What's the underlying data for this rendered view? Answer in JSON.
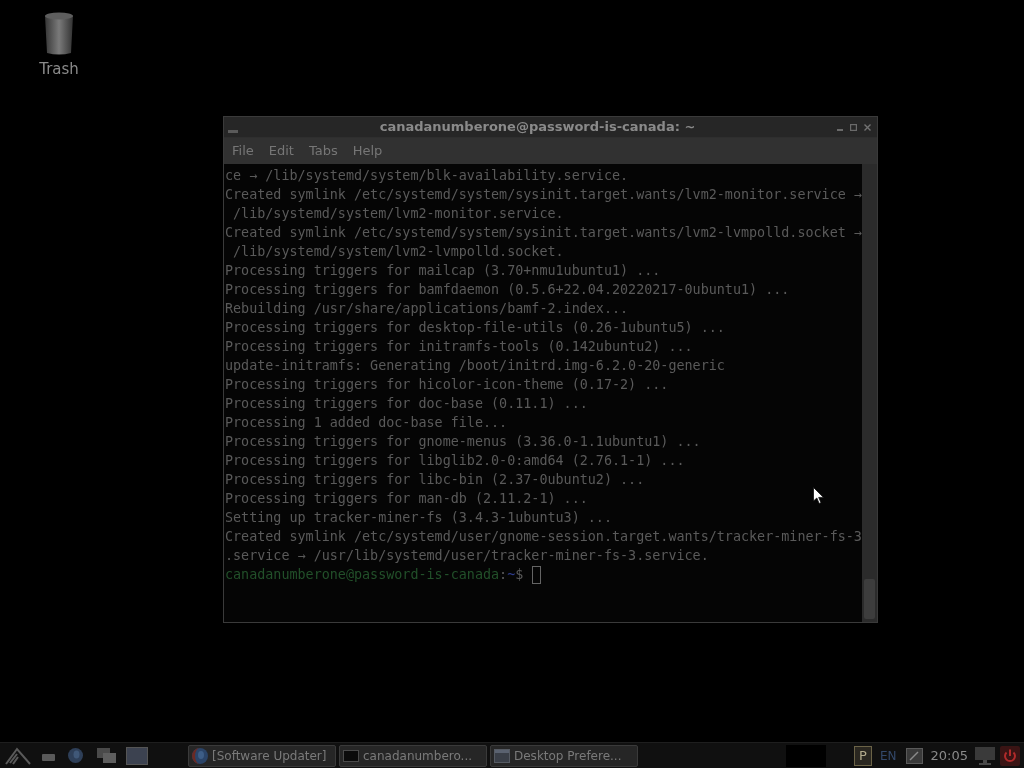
{
  "desktop": {
    "icons": [
      {
        "label": "Trash"
      }
    ]
  },
  "window": {
    "title": "canadanumberone@password-is-canada: ~",
    "menu": [
      "File",
      "Edit",
      "Tabs",
      "Help"
    ],
    "terminal": {
      "lines": [
        "ce → /lib/systemd/system/blk-availability.service.",
        "Created symlink /etc/systemd/system/sysinit.target.wants/lvm2-monitor.service →",
        " /lib/systemd/system/lvm2-monitor.service.",
        "Created symlink /etc/systemd/system/sysinit.target.wants/lvm2-lvmpolld.socket →",
        " /lib/systemd/system/lvm2-lvmpolld.socket.",
        "Processing triggers for mailcap (3.70+nmu1ubuntu1) ...",
        "Processing triggers for bamfdaemon (0.5.6+22.04.20220217-0ubuntu1) ...",
        "Rebuilding /usr/share/applications/bamf-2.index...",
        "Processing triggers for desktop-file-utils (0.26-1ubuntu5) ...",
        "Processing triggers for initramfs-tools (0.142ubuntu2) ...",
        "update-initramfs: Generating /boot/initrd.img-6.2.0-20-generic",
        "Processing triggers for hicolor-icon-theme (0.17-2) ...",
        "Processing triggers for doc-base (0.11.1) ...",
        "Processing 1 added doc-base file...",
        "Processing triggers for gnome-menus (3.36.0-1.1ubuntu1) ...",
        "Processing triggers for libglib2.0-0:amd64 (2.76.1-1) ...",
        "Processing triggers for libc-bin (2.37-0ubuntu2) ...",
        "Processing triggers for man-db (2.11.2-1) ...",
        "Setting up tracker-miner-fs (3.4.3-1ubuntu3) ...",
        "Created symlink /etc/systemd/user/gnome-session.target.wants/tracker-miner-fs-3",
        ".service → /usr/lib/systemd/user/tracker-miner-fs-3.service."
      ],
      "prompt": {
        "user_host": "canadanumberone@password-is-canada",
        "separator": ":",
        "path": "~",
        "symbol": "$"
      }
    }
  },
  "taskbar": {
    "tasks": [
      {
        "label": "[Software Updater]",
        "kind": "updater"
      },
      {
        "label": "canadanumbero...",
        "kind": "terminal"
      },
      {
        "label": "Desktop Prefere...",
        "kind": "preferences"
      }
    ],
    "tray": {
      "indicator": "P",
      "language": "EN",
      "clock": "20:05"
    }
  }
}
